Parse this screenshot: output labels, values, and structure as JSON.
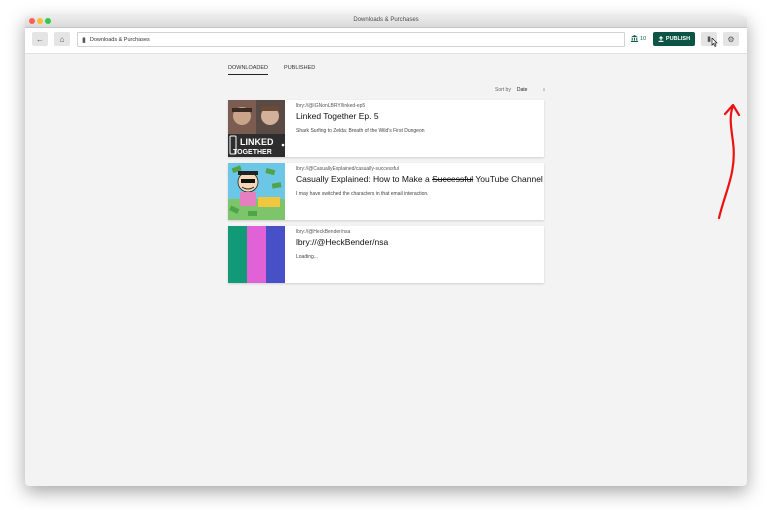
{
  "window": {
    "title": "Downloads & Purchases"
  },
  "toolbar": {
    "back_icon": "arrow-left-icon",
    "home_icon": "home-icon",
    "address": "Downloads & Purchases",
    "balance": "10",
    "publish_label": "PUBLISH",
    "downloads_icon": "folder-icon",
    "settings_icon": "gear-icon"
  },
  "tabs": [
    {
      "label": "DOWNLOADED",
      "active": true
    },
    {
      "label": "PUBLISHED",
      "active": false
    }
  ],
  "sort": {
    "label": "Sort by",
    "value": "Date"
  },
  "items": [
    {
      "uri": "lbry://@IGNonLBRY/linked-ep5",
      "title": "Linked Together Ep. 5",
      "description": "Shark Surfing to Zelda: Breath of the Wild's First Dungeon",
      "thumb_text": "LINKED TOGETHER"
    },
    {
      "uri": "lbry://@CasuallyExplained/casually-successful",
      "title_pre": "Casually Explained: How to Make a ",
      "title_strike": "Successful",
      "title_post": " YouTube Channel",
      "description": "I may have switched the characters in that email interaction."
    },
    {
      "uri": "lbry://@HeckBender/nsa",
      "title": "lbry://@HeckBender/nsa",
      "description": "Loading..."
    }
  ]
}
